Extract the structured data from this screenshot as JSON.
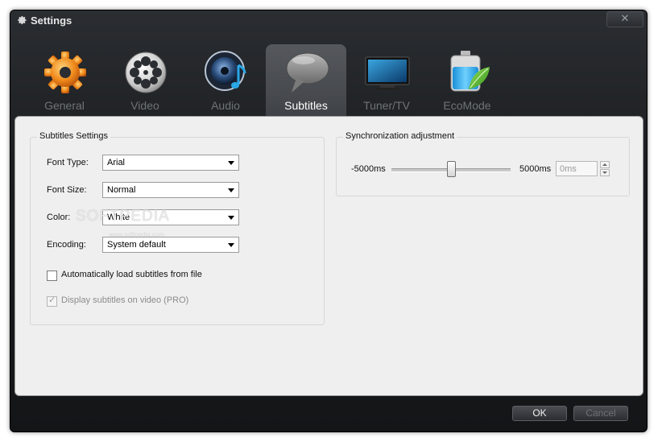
{
  "window": {
    "title": "Settings",
    "close_label": "✕",
    "icon": "gear-icon"
  },
  "tabs": [
    {
      "label": "General",
      "icon": "gear-icon",
      "active": false
    },
    {
      "label": "Video",
      "icon": "film-reel-icon",
      "active": false
    },
    {
      "label": "Audio",
      "icon": "speaker-music-icon",
      "active": false
    },
    {
      "label": "Subtitles",
      "icon": "speech-bubble-icon",
      "active": true
    },
    {
      "label": "Tuner/TV",
      "icon": "tv-icon",
      "active": false
    },
    {
      "label": "EcoMode",
      "icon": "battery-leaf-icon",
      "active": false
    }
  ],
  "subtitles_settings": {
    "legend": "Subtitles Settings",
    "font_type": {
      "label": "Font Type:",
      "value": "Arial"
    },
    "font_size": {
      "label": "Font Size:",
      "value": "Normal"
    },
    "color": {
      "label": "Color:",
      "value": "White"
    },
    "encoding": {
      "label": "Encoding:",
      "value": "System default"
    },
    "auto_load": {
      "label": "Automatically load subtitles from file",
      "checked": false
    },
    "display_on_video": {
      "label": "Display subtitles on video (PRO)",
      "checked": true,
      "disabled": true
    }
  },
  "sync": {
    "legend": "Synchronization adjustment",
    "min_label": "-5000ms",
    "max_label": "5000ms",
    "value": 0,
    "input_value": "0ms"
  },
  "footer": {
    "ok_label": "OK",
    "cancel_label": "Cancel"
  },
  "watermark": {
    "text": "SOFTPEDIA",
    "sub": "www.softpedia.com"
  },
  "colors": {
    "window_bg": "#1b1d20",
    "content_bg": "#efefef",
    "active_tab_bg": "#4f5257",
    "gear_orange": "#f08a1c",
    "eco_green": "#4caf2f"
  }
}
